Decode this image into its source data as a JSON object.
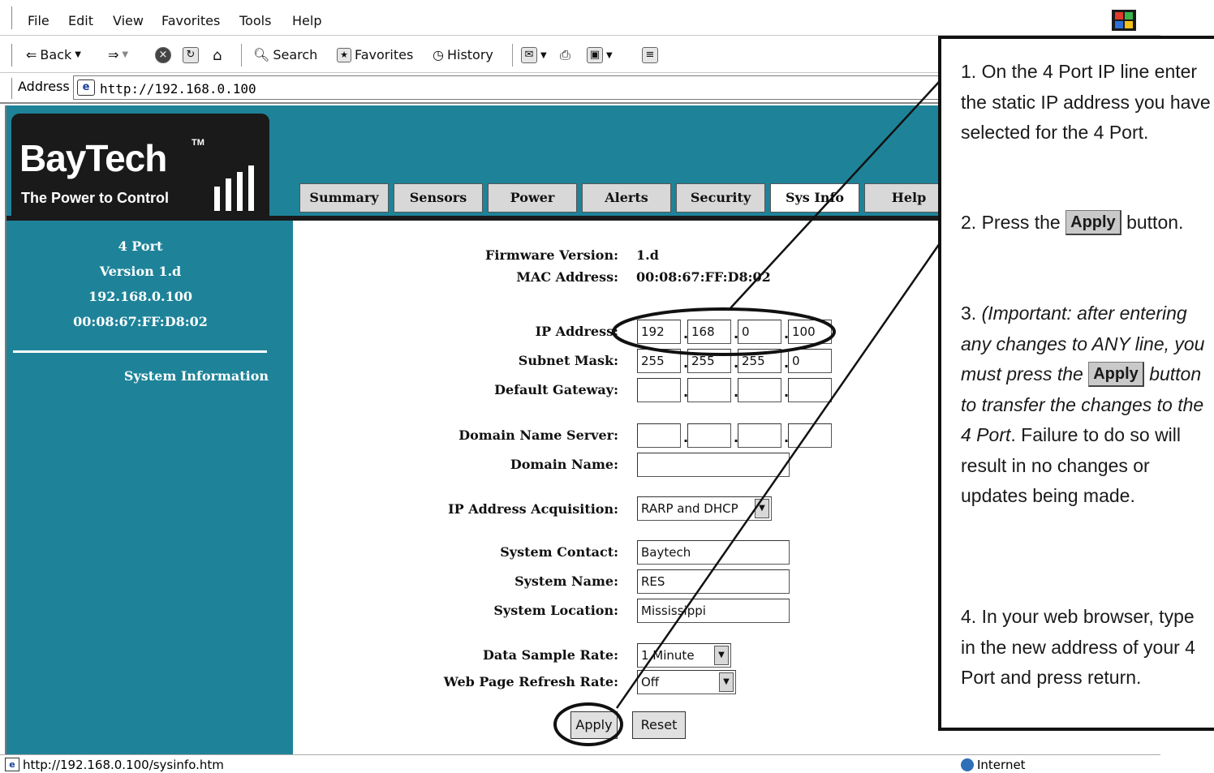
{
  "browser": {
    "menu": [
      "File",
      "Edit",
      "View",
      "Favorites",
      "Tools",
      "Help"
    ],
    "toolbar": {
      "back": "Back",
      "search": "Search",
      "favorites": "Favorites",
      "history": "History"
    },
    "address_label": "Address",
    "address_value": "http://192.168.0.100"
  },
  "brand": {
    "name": "BayTech",
    "tm": "TM",
    "tagline": "The Power to Control"
  },
  "tabs": [
    "Summary",
    "Sensors",
    "Power",
    "Alerts",
    "Security",
    "Sys Info",
    "Help"
  ],
  "active_tab": "Sys Info",
  "sidebar": {
    "device": "4 Port",
    "version": "Version 1.d",
    "ip": "192.168.0.100",
    "mac": "00:08:67:FF:D8:02",
    "link": "System Information"
  },
  "form": {
    "firmware_label": "Firmware Version:",
    "firmware_value": "1.d",
    "mac_label": "MAC Address:",
    "mac_value": "00:08:67:FF:D8:02",
    "ip_label": "IP Address:",
    "ip": [
      "192",
      "168",
      "0",
      "100"
    ],
    "subnet_label": "Subnet Mask:",
    "subnet": [
      "255",
      "255",
      "255",
      "0"
    ],
    "gateway_label": "Default Gateway:",
    "gateway": [
      "",
      "",
      "",
      ""
    ],
    "dns_label": "Domain Name Server:",
    "dns": [
      "",
      "",
      "",
      ""
    ],
    "domain_label": "Domain Name:",
    "domain_value": "",
    "acq_label": "IP Address Acquisition:",
    "acq_value": "RARP and DHCP",
    "contact_label": "System Contact:",
    "contact_value": "Baytech",
    "name_label": "System Name:",
    "name_value": "RES",
    "location_label": "System Location:",
    "location_value": "Mississippi",
    "sample_label": "Data Sample Rate:",
    "sample_value": "1 Minute",
    "refresh_label": "Web Page Refresh Rate:",
    "refresh_value": "Off",
    "apply": "Apply",
    "reset": "Reset"
  },
  "status": {
    "url": "http://192.168.0.100/sysinfo.htm",
    "zone": "Internet"
  },
  "instructions": {
    "step1": "1. On the 4 Port IP line enter the static IP address you have selected for the 4 Port.",
    "step2_before": "2. Press the",
    "step2_button": "Apply",
    "step2_after": "button.",
    "step3_num": "3.",
    "step3_a": "(Important: after entering any changes to ANY line, you must press the",
    "step3_button": "Apply",
    "step3_b": "button to transfer the changes to the 4 Port",
    "step3_c": ". Failure to do so will result in no changes or updates being made.",
    "step4": "4. In your web browser, type in the new address of your 4 Port and press return."
  }
}
